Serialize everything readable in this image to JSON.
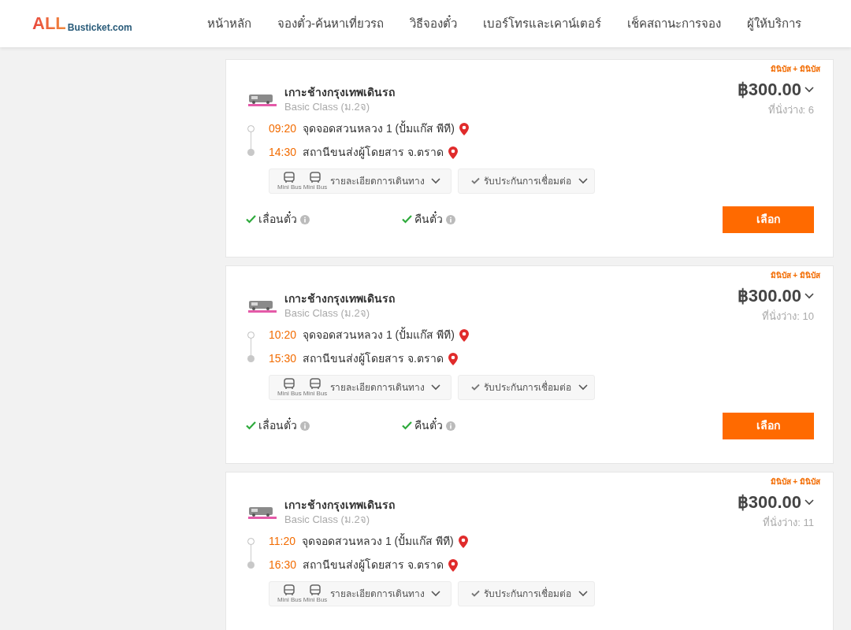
{
  "header": {
    "logo": {
      "mark": "ALL",
      "text": "Busticket.com"
    },
    "nav": [
      {
        "label": "หน้าหลัก"
      },
      {
        "label": "จองตั๋ว-ค้นหาเที่ยวรถ"
      },
      {
        "label": "วิธีจองตั๋ว"
      },
      {
        "label": "เบอร์โทรและเคาน์เตอร์"
      },
      {
        "label": "เช็คสถานะการจอง"
      },
      {
        "label": "ผู้ให้บริการ"
      }
    ]
  },
  "trips": [
    {
      "tag": "มินิบัส + มินิบัส",
      "route": "เกาะช้างกรุงเทพเดินรถ",
      "class": "Basic Class (ม.2จ)",
      "price": "฿300.00",
      "seats": "ที่นั่งว่าง: 6",
      "stops": [
        {
          "kind": "departure",
          "time": "09:20",
          "place": "จุดจอดสวนหลวง 1 (ปั้มแก๊ส พีที)"
        },
        {
          "kind": "arrival",
          "time": "14:30",
          "place": "สถานีขนส่งผู้โดยสาร จ.ตราด"
        }
      ],
      "vehicles": [
        "Mini Bus",
        "Mini Bus"
      ],
      "details": "รายละเอียดการเดินทาง",
      "insurance": "รับประกันการเชื่อมต่อ",
      "features": [
        "เลื่อนตั๋ว",
        "คืนตั๋ว"
      ],
      "button": "เลือก"
    },
    {
      "tag": "มินิบัส + มินิบัส",
      "route": "เกาะช้างกรุงเทพเดินรถ",
      "class": "Basic Class (ม.2จ)",
      "price": "฿300.00",
      "seats": "ที่นั่งว่าง: 10",
      "stops": [
        {
          "kind": "departure",
          "time": "10:20",
          "place": "จุดจอดสวนหลวง 1 (ปั้มแก๊ส พีที)"
        },
        {
          "kind": "arrival",
          "time": "15:30",
          "place": "สถานีขนส่งผู้โดยสาร จ.ตราด"
        }
      ],
      "vehicles": [
        "Mini Bus",
        "Mini Bus"
      ],
      "details": "รายละเอียดการเดินทาง",
      "insurance": "รับประกันการเชื่อมต่อ",
      "features": [
        "เลื่อนตั๋ว",
        "คืนตั๋ว"
      ],
      "button": "เลือก"
    },
    {
      "tag": "มินิบัส + มินิบัส",
      "route": "เกาะช้างกรุงเทพเดินรถ",
      "class": "Basic Class (ม.2จ)",
      "price": "฿300.00",
      "seats": "ที่นั่งว่าง: 11",
      "stops": [
        {
          "kind": "departure",
          "time": "11:20",
          "place": "จุดจอดสวนหลวง 1 (ปั้มแก๊ส พีที)"
        },
        {
          "kind": "arrival",
          "time": "16:30",
          "place": "สถานีขนส่งผู้โดยสาร จ.ตราด"
        }
      ],
      "vehicles": [
        "Mini Bus",
        "Mini Bus"
      ],
      "details": "รายละเอียดการเดินทาง",
      "insurance": "รับประกันการเชื่อมต่อ"
    }
  ]
}
